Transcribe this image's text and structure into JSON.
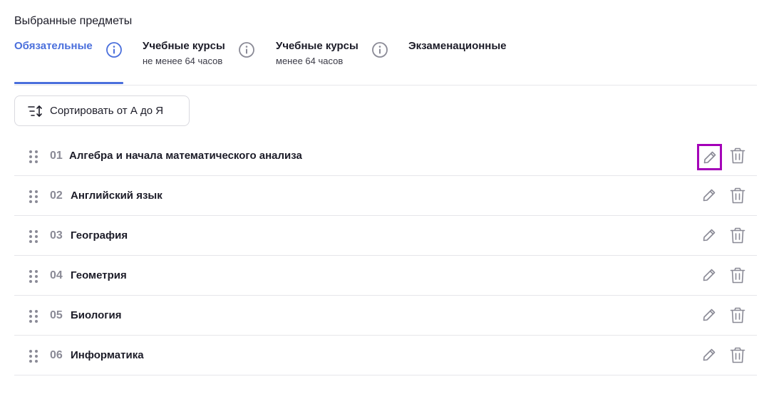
{
  "page": {
    "title": "Выбранные предметы"
  },
  "tabs": [
    {
      "label": "Обязательные",
      "sub": "",
      "active": true
    },
    {
      "label": "Учебные курсы",
      "sub": "не менее 64 часов",
      "active": false
    },
    {
      "label": "Учебные курсы",
      "sub": "менее 64 часов",
      "active": false
    },
    {
      "label": "Экзаменационные",
      "sub": "",
      "active": false
    }
  ],
  "sort": {
    "label": "Сортировать от А до Я",
    "icon": "sort-icon"
  },
  "subjects": [
    {
      "num": "01",
      "name": "Алгебра и начала математического анализа"
    },
    {
      "num": "02",
      "name": "Английский язык"
    },
    {
      "num": "03",
      "name": "География"
    },
    {
      "num": "04",
      "name": "Геометрия"
    },
    {
      "num": "05",
      "name": "Биология"
    },
    {
      "num": "06",
      "name": "Информатика"
    }
  ],
  "icons": {
    "drag": "drag-handle-icon",
    "edit": "pencil-icon",
    "delete": "trash-icon",
    "info": "info-icon"
  },
  "colors": {
    "accent": "#4a6fdc",
    "highlight": "#a400b8",
    "muted": "#8a8a96"
  }
}
